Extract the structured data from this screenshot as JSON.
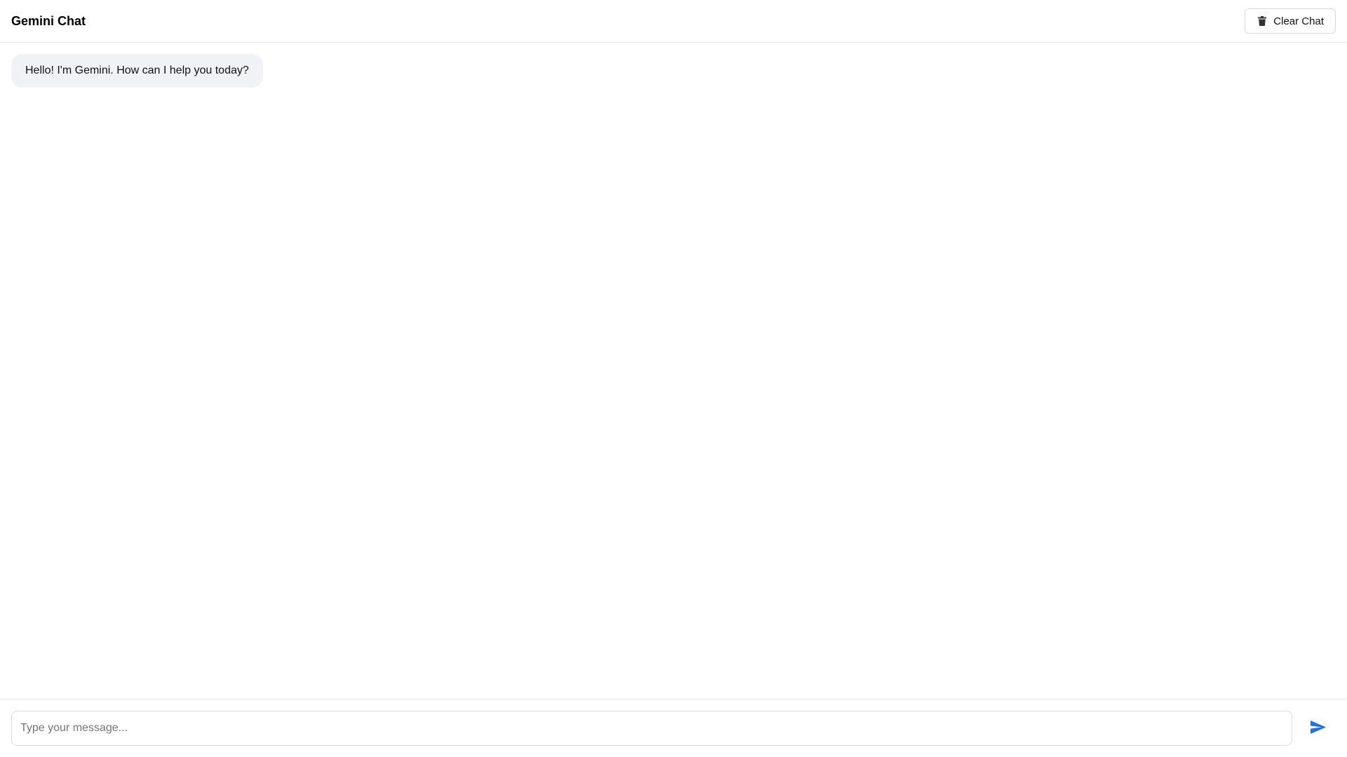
{
  "header": {
    "title": "Gemini Chat",
    "clear_button": {
      "label": "Clear Chat",
      "icon": "trash-icon"
    }
  },
  "messages": [
    {
      "role": "assistant",
      "text": "Hello! I'm Gemini. How can I help you today?"
    }
  ],
  "composer": {
    "placeholder": "Type your message...",
    "value": "",
    "send_icon": "send-icon"
  },
  "colors": {
    "accent": "#1a73e8",
    "bubble_bg": "#f0f2f5",
    "border": "#e3e3e3"
  }
}
